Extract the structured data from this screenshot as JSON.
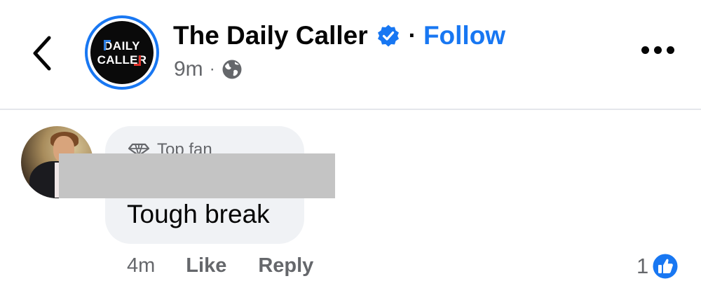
{
  "header": {
    "page_name": "The Daily Caller",
    "logo_line1": "DAILY",
    "logo_line2": "CALLER",
    "follow_label": "Follow",
    "separator": "·",
    "post_age": "9m",
    "meta_separator": "·",
    "icons": {
      "back": "chevron-left-icon",
      "verified": "verified-badge-icon",
      "audience": "globe-icon",
      "more": "more-dots-icon"
    }
  },
  "comment": {
    "badge_label": "Top fan",
    "text": "Tough break",
    "age": "4m",
    "like_label": "Like",
    "reply_label": "Reply",
    "reaction_count": "1",
    "icons": {
      "badge": "diamond-icon",
      "reaction": "thumbs-up-icon"
    }
  },
  "colors": {
    "accent": "#1877f2",
    "secondary_text": "#65676b",
    "bubble": "#f0f2f5",
    "redaction": "#c4c4c4"
  }
}
